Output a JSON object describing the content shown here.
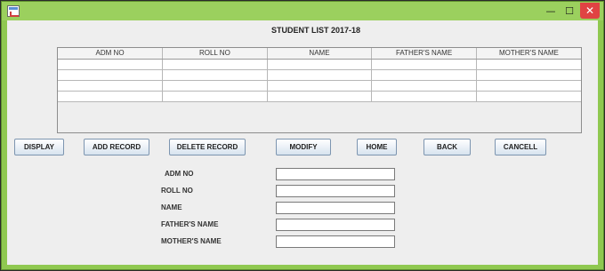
{
  "window": {
    "app_icon": "java-app-icon",
    "minimize_glyph": "—",
    "maximize_glyph": "☐",
    "close_glyph": "✕"
  },
  "heading": "STUDENT LIST 2017-18",
  "table": {
    "columns": [
      "ADM NO",
      "ROLL NO",
      "NAME",
      "FATHER'S NAME",
      "MOTHER'S NAME"
    ],
    "rows": [
      [
        "",
        "",
        "",
        "",
        ""
      ],
      [
        "",
        "",
        "",
        "",
        ""
      ],
      [
        "",
        "",
        "",
        "",
        ""
      ],
      [
        "",
        "",
        "",
        "",
        ""
      ]
    ]
  },
  "buttons": {
    "display": "DISPLAY",
    "add_record": "ADD RECORD",
    "delete_record": "DELETE RECORD",
    "modify": "MODIFY",
    "home": "HOME",
    "back": "BACK",
    "cancel": "CANCELL"
  },
  "form": {
    "adm_no": {
      "label": "ADM NO",
      "value": ""
    },
    "roll_no": {
      "label": "ROLL NO",
      "value": ""
    },
    "name": {
      "label": "NAME",
      "value": ""
    },
    "fathers_name": {
      "label": "FATHER'S NAME",
      "value": ""
    },
    "mothers_name": {
      "label": "MOTHER'S NAME",
      "value": ""
    }
  },
  "colors": {
    "frame": "#8fc850",
    "close_button": "#e04343",
    "content_bg": "#eeeeee"
  }
}
